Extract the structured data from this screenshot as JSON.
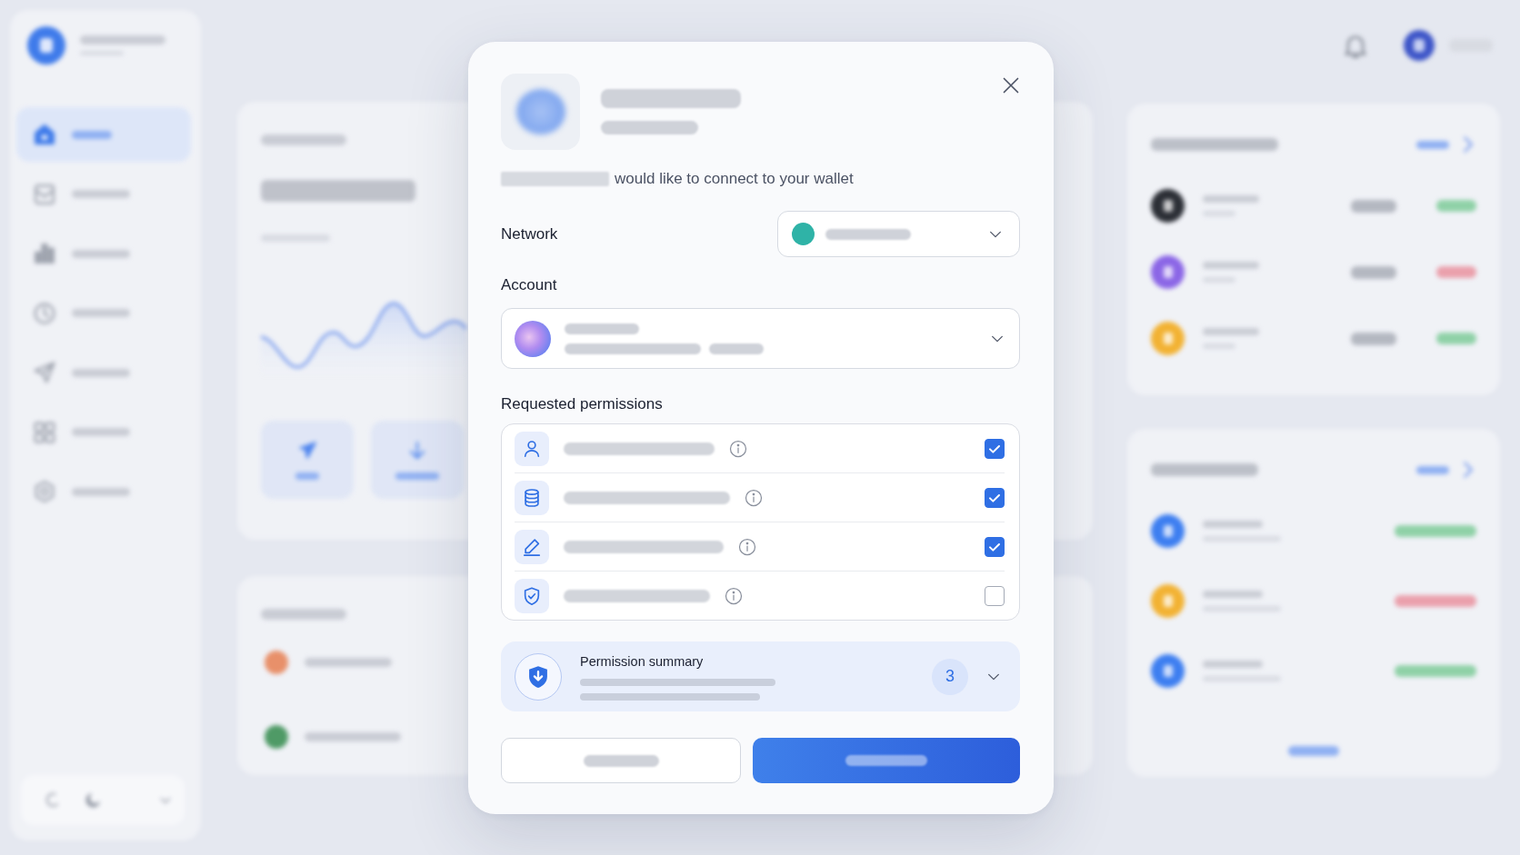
{
  "backdrop": {
    "sidebar": {
      "items": [
        {
          "kind": "home",
          "selected": true
        },
        {
          "kind": "mail",
          "selected": false
        },
        {
          "kind": "chart",
          "selected": false
        },
        {
          "kind": "clock",
          "selected": false
        },
        {
          "kind": "send",
          "selected": false
        },
        {
          "kind": "apps",
          "selected": false
        },
        {
          "kind": "settings",
          "selected": false
        }
      ]
    },
    "holdings": [
      {
        "color": "#e8906a"
      },
      {
        "color": "#4f9a66"
      }
    ],
    "watchlist": [
      {
        "color": "#2c2f36",
        "change": {
          "color": "#8fd1a7"
        }
      },
      {
        "color": "#8b66e6",
        "change": {
          "color": "#eaa0ac"
        }
      },
      {
        "color": "#f2b233",
        "change": {
          "color": "#8fd1a7"
        }
      }
    ],
    "activity": [
      {
        "color": "#3d7ef0",
        "amount": {
          "color": "#8fd1a7"
        }
      },
      {
        "color": "#f2b233",
        "amount": {
          "color": "#eaa0ac"
        }
      },
      {
        "color": "#3d7ef0",
        "amount": {
          "color": "#8fd1a7"
        }
      }
    ]
  },
  "dialog": {
    "message": "would like to connect to your wallet",
    "network": {
      "label": "Network"
    },
    "account": {
      "label": "Account"
    },
    "permissions": {
      "title": "Requested permissions",
      "items": [
        {
          "kind": "person",
          "checked": true
        },
        {
          "kind": "database",
          "checked": true
        },
        {
          "kind": "pen",
          "checked": true
        },
        {
          "kind": "shield",
          "checked": false
        }
      ]
    },
    "summary": {
      "title": "Permission summary",
      "count": "3"
    }
  }
}
